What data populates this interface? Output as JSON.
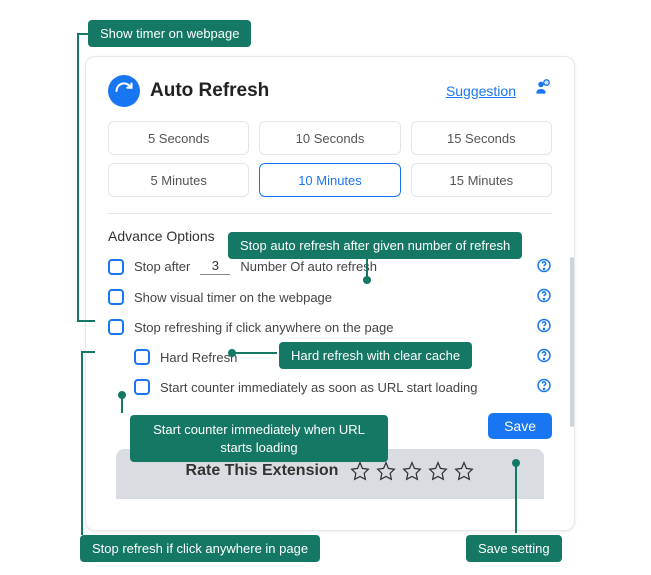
{
  "callouts": {
    "show_timer": "Show timer on webpage",
    "stop_count": "Stop auto refresh after given number of refresh",
    "hard": "Hard refresh with clear cache",
    "start_counter": "Start counter immediately when URL starts loading",
    "stop_click": "Stop refresh if click anywhere in page",
    "save": "Save setting"
  },
  "header": {
    "title": "Auto Refresh",
    "suggestion": "Suggestion"
  },
  "presets": {
    "row1": [
      {
        "label": "5 Seconds",
        "active": false
      },
      {
        "label": "10 Seconds",
        "active": false
      },
      {
        "label": "15 Seconds",
        "active": false
      }
    ],
    "row2": [
      {
        "label": "5 Minutes",
        "active": false
      },
      {
        "label": "10 Minutes",
        "active": true
      },
      {
        "label": "15 Minutes",
        "active": false
      }
    ]
  },
  "section_title": "Advance Options",
  "options": {
    "stop_after_pre": "Stop after",
    "stop_after_value": "3",
    "stop_after_post": "Number Of auto refresh",
    "show_visual": "Show visual timer on the webpage",
    "stop_click": "Stop refreshing if click anywhere on the page",
    "hard_refresh": "Hard Refresh",
    "start_counter": "Start counter immediately as soon as URL start loading"
  },
  "save_label": "Save",
  "rate_label": "Rate This Extension"
}
